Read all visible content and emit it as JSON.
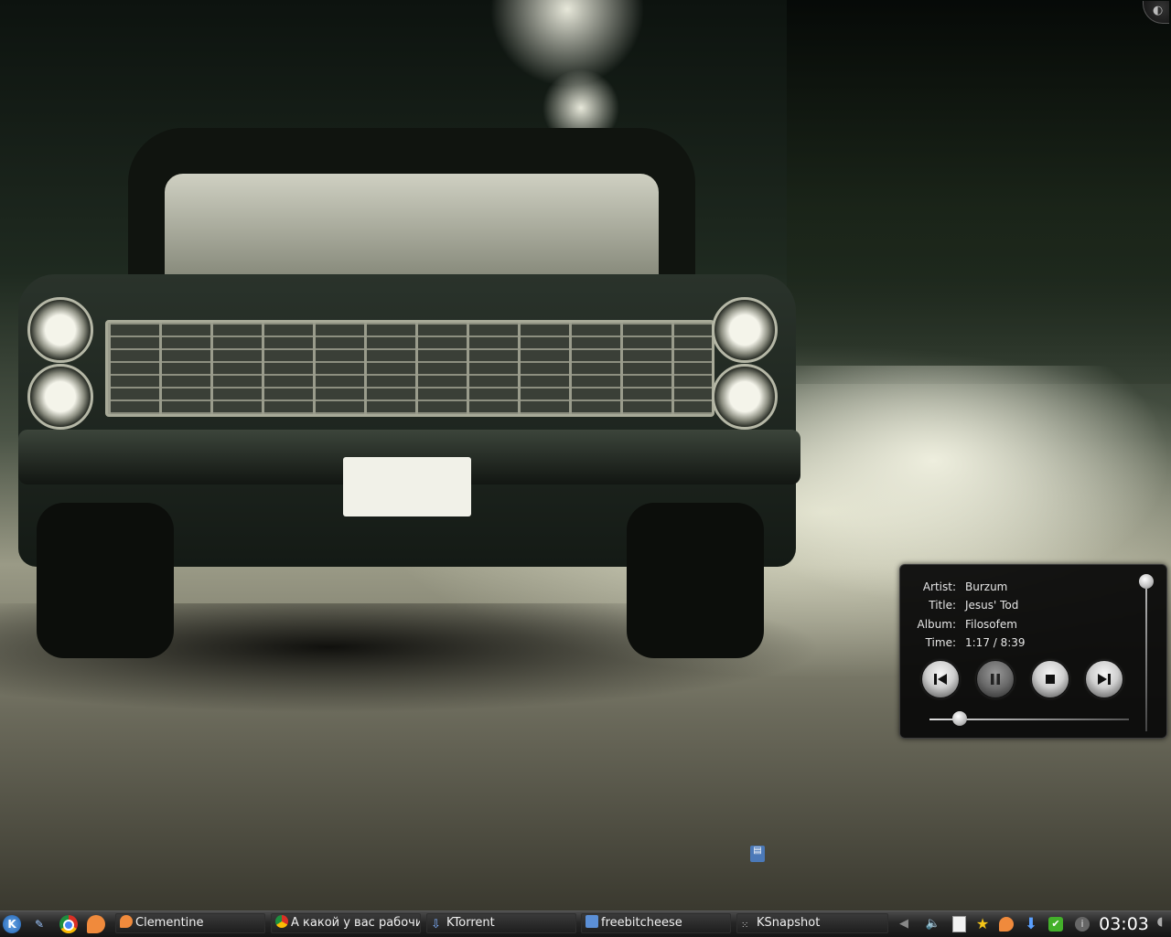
{
  "desktop": {
    "wallpaper": "vintage car parked on wet street at night"
  },
  "player": {
    "artist_label": "Artist:",
    "artist": "Burzum",
    "title_label": "Title:",
    "title": "Jesus' Tod",
    "album_label": "Album:",
    "album": "Filosofem",
    "time_label": "Time:",
    "time": "1:17 / 8:39",
    "progress_fraction": 0.15,
    "volume_fraction": 1.0,
    "controls": [
      "previous-icon",
      "pause-icon",
      "stop-icon",
      "next-icon"
    ]
  },
  "taskbar": {
    "launchers": [
      "kde-menu-icon",
      "kmail-icon",
      "chrome-icon",
      "clementine-icon"
    ],
    "tasks": [
      {
        "label": "Clementine",
        "icon": "clementine-icon"
      },
      {
        "label": "А какой у вас рабочи",
        "icon": "chrome-icon"
      },
      {
        "label": "KTorrent",
        "icon": "ktorrent-icon"
      },
      {
        "label": "freebitcheese",
        "icon": "kopete-icon"
      },
      {
        "label": "KSnapshot",
        "icon": "ksnapshot-icon"
      }
    ],
    "tray": [
      "tray-arrow-icon",
      "volume-icon",
      "clipboard-icon",
      "star-icon",
      "clementine-icon",
      "download-icon",
      "update-ok-icon",
      "notifications-icon"
    ],
    "clock": "03:03",
    "colors": {
      "accent": "#3a7bd5",
      "panel": "#1e1e1e"
    }
  }
}
